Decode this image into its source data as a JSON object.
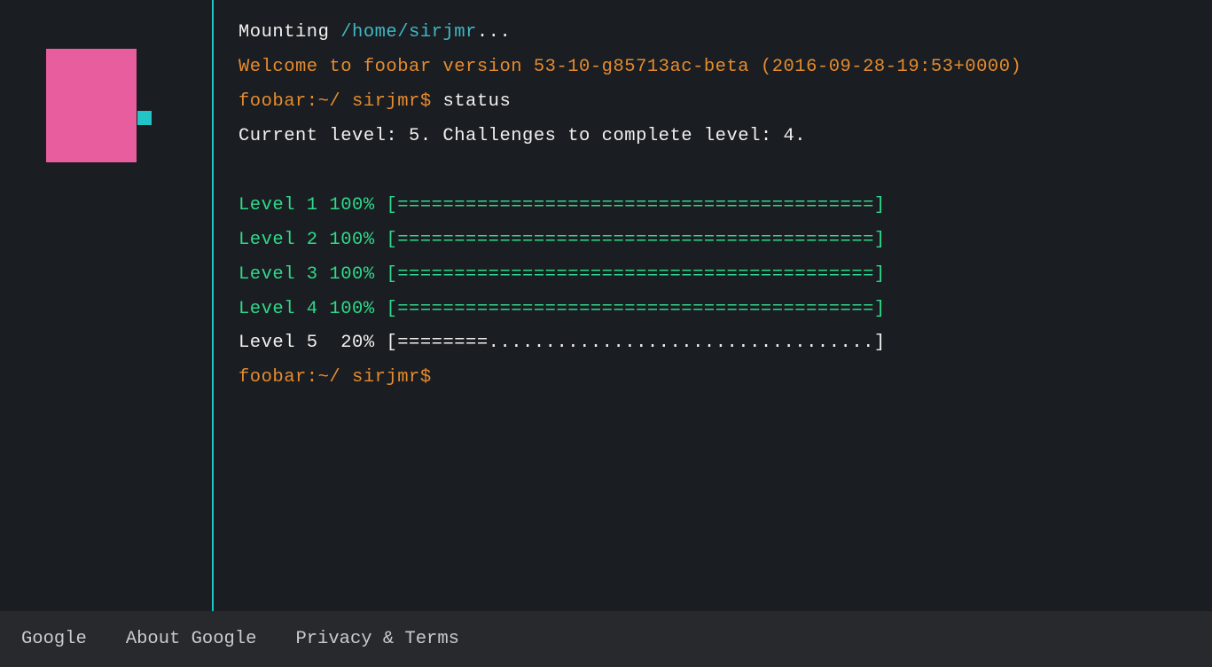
{
  "terminal": {
    "mounting": {
      "prefix": "Mounting ",
      "path": "/home/sirjmr",
      "suffix": "..."
    },
    "welcome": "Welcome to foobar version 53-10-g85713ac-beta (2016-09-28-19:53+0000)",
    "prompt1": "foobar:~/ sirjmr$ ",
    "command1": "status",
    "status_line": "Current level: 5. Challenges to complete level: 4.",
    "levels": [
      {
        "label": "Level 1 100% ",
        "bar": "[==========================================]",
        "complete": true
      },
      {
        "label": "Level 2 100% ",
        "bar": "[==========================================]",
        "complete": true
      },
      {
        "label": "Level 3 100% ",
        "bar": "[==========================================]",
        "complete": true
      },
      {
        "label": "Level 4 100% ",
        "bar": "[==========================================]",
        "complete": true
      },
      {
        "label": "Level 5  20% ",
        "bar": "[========..................................]",
        "complete": false
      }
    ],
    "prompt2": "foobar:~/ sirjmr$"
  },
  "footer": {
    "links": [
      "Google",
      "About Google",
      "Privacy & Terms"
    ]
  }
}
